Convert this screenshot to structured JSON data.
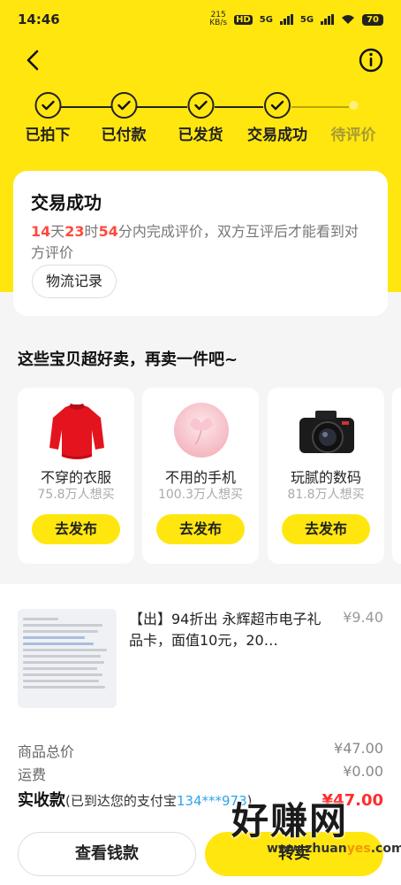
{
  "status_bar": {
    "time": "14:46",
    "speed_value": "215",
    "speed_unit": "KB/s",
    "hd_label": "HD",
    "network1": "5G",
    "network2": "5G",
    "battery": "70"
  },
  "steps": [
    {
      "label": "已拍下",
      "state": "done"
    },
    {
      "label": "已付款",
      "state": "done"
    },
    {
      "label": "已发货",
      "state": "done"
    },
    {
      "label": "交易成功",
      "state": "done"
    },
    {
      "label": "待评价",
      "state": "pending"
    }
  ],
  "status_card": {
    "title": "交易成功",
    "days": "14",
    "days_unit": "天",
    "hours": "23",
    "hours_unit": "时",
    "minutes": "54",
    "desc_rest": "分内完成评价，双方互评后才能看到对方评价",
    "logistics_button": "物流记录"
  },
  "recommend": {
    "title": "这些宝贝超好卖，再卖一件吧~",
    "items": [
      {
        "name": "不穿的衣服",
        "count": "75.8万人想买",
        "button": "去发布",
        "icon": "sweater-image"
      },
      {
        "name": "不用的手机",
        "count": "100.3万人想买",
        "button": "去发布",
        "icon": "phone-image"
      },
      {
        "name": "玩腻的数码",
        "count": "81.8万人想买",
        "button": "去发布",
        "icon": "camera-image"
      }
    ]
  },
  "order": {
    "title": "【出】94折出  永辉超市电子礼品卡，面值10元，20…",
    "price": "¥9.40",
    "goods_total_label": "商品总价",
    "goods_total": "¥47.00",
    "shipping_label": "运费",
    "shipping": "¥0.00",
    "received_label": "实收款",
    "received_note_prefix": "(已到达您的支付宝",
    "received_account": "134***973",
    "received_note_suffix": ")",
    "received_amount": "¥47.00"
  },
  "buttons": {
    "wallet": "查看钱款",
    "resell": "转卖"
  },
  "watermark": {
    "big": "好赚网",
    "small_a": "www.zhuan",
    "small_b": "yes",
    "small_c": ".com"
  },
  "colors": {
    "brand_yellow": "#ffe60f",
    "countdown_red": "#ff4a3d",
    "amount_red": "#ff2d2d",
    "account_blue": "#2fa4e7"
  }
}
